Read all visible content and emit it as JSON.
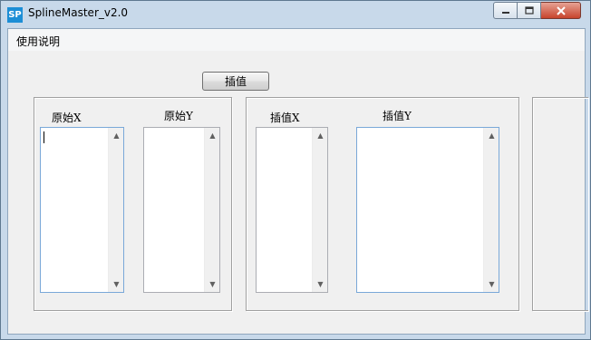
{
  "window": {
    "title": "SplineMaster_v2.0",
    "icon_text": "SP"
  },
  "caption": {
    "minimize_icon": "minimize-icon",
    "maximize_icon": "maximize-icon",
    "close_icon": "close-icon"
  },
  "menu": {
    "items": [
      "使用说明"
    ]
  },
  "toolbar": {
    "interpolate_label": "插值"
  },
  "left_group": {
    "original_x_label": "原始X",
    "original_y_label": "原始Y",
    "original_x_value": "",
    "original_y_value": ""
  },
  "right_group": {
    "interp_x_label": "插值X",
    "interp_y_label": "插值Y",
    "interp_x_value": "",
    "interp_y_value": ""
  },
  "colors": {
    "accent": "#1c8ed6",
    "close_button": "#c7442c",
    "window_frame": "#c8d9ea",
    "client_bg": "#f0f0f0"
  }
}
